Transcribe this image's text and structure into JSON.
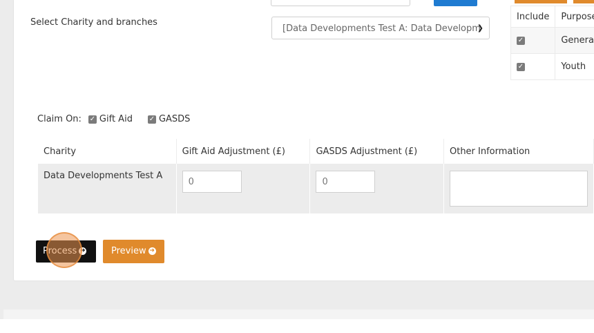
{
  "form": {
    "select_label": "Select Charity and branches",
    "charity_select_value": "[Data Developments Test A: Data Developm"
  },
  "purposes_table": {
    "headers": [
      "Include",
      "Purpose"
    ],
    "rows": [
      {
        "checked": true,
        "purpose": "General"
      },
      {
        "checked": true,
        "purpose": "Youth"
      }
    ]
  },
  "claim_on": {
    "label": "Claim On:",
    "options": [
      {
        "label": "Gift Aid",
        "checked": true
      },
      {
        "label": "GASDS",
        "checked": true
      }
    ]
  },
  "adjust_table": {
    "headers": [
      "Charity",
      "Gift Aid Adjustment (£)",
      "GASDS Adjustment (£)",
      "Other Information"
    ],
    "rows": [
      {
        "charity": "Data Developments Test A",
        "gift_aid_adjustment": "0",
        "gasds_adjustment": "0",
        "other_information": ""
      }
    ]
  },
  "actions": {
    "process_label": "Process",
    "preview_label": "Preview",
    "arrow_icon": "arrow-circle-right-icon"
  },
  "colors": {
    "primary_blue": "#1f7bd1",
    "accent_orange": "#e08a2c",
    "process_black": "#111111"
  }
}
